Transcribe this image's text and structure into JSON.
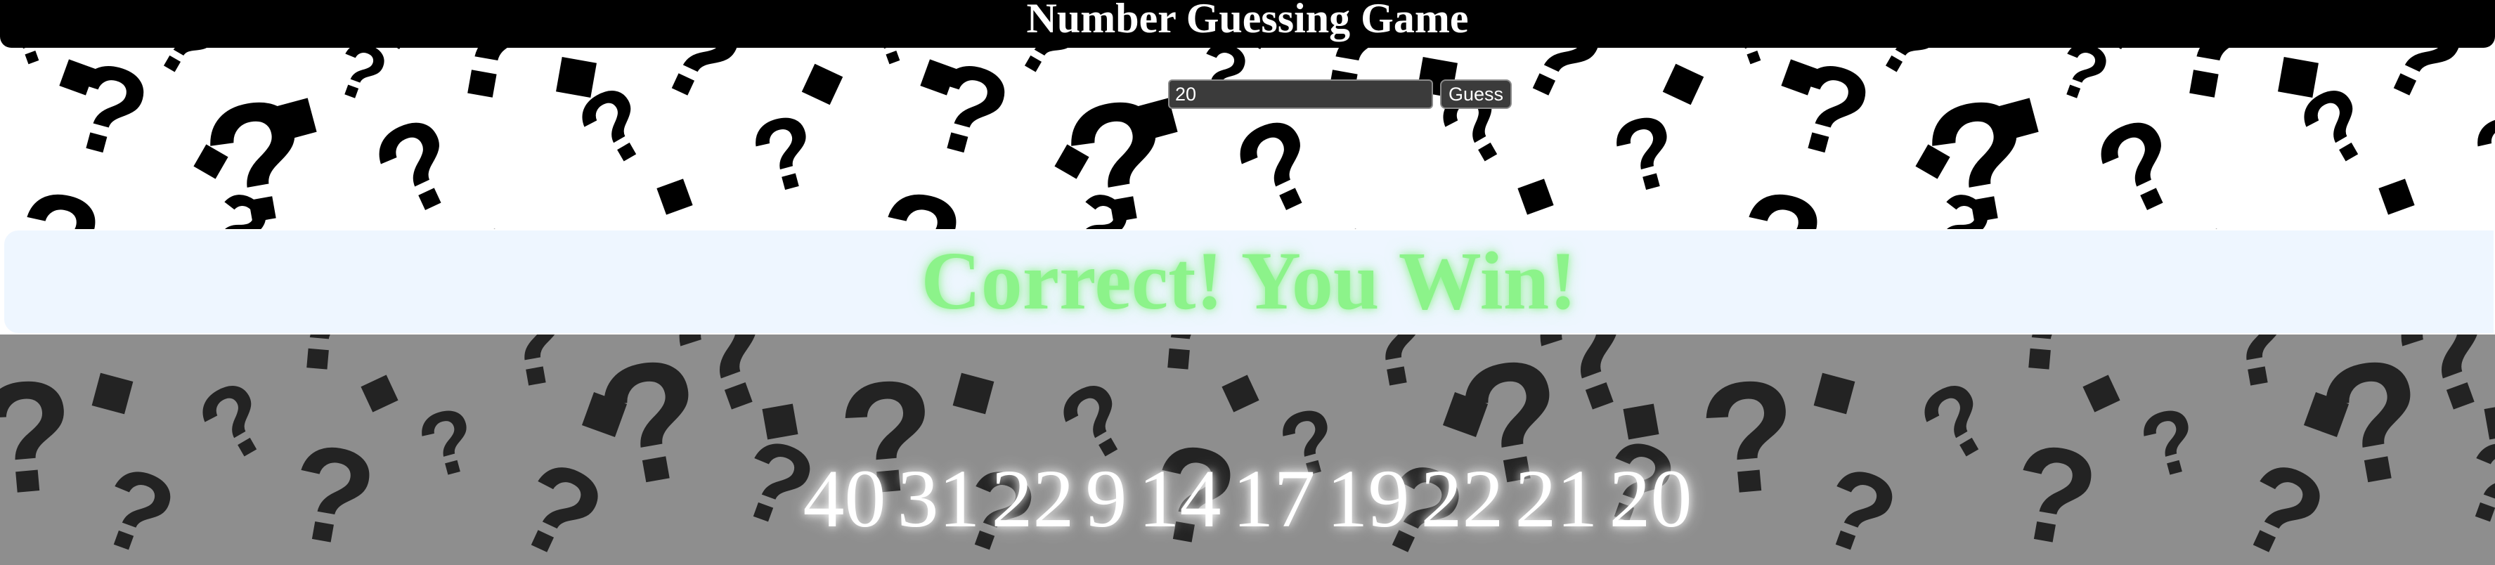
{
  "header": {
    "title": "Number Guessing Game",
    "background_color": "#000000"
  },
  "guess_form": {
    "input_value": "20",
    "button_label": "Guess"
  },
  "result": {
    "message": "Correct! You Win!",
    "color": "#8cf38a",
    "panel_color": "#eef6ff"
  },
  "guess_history": [
    "40",
    "31",
    "22",
    "9",
    "14",
    "17",
    "19",
    "22",
    "21",
    "20"
  ],
  "background": {
    "pattern_icon": "question-mark-icon",
    "pattern_color": "#000000"
  }
}
